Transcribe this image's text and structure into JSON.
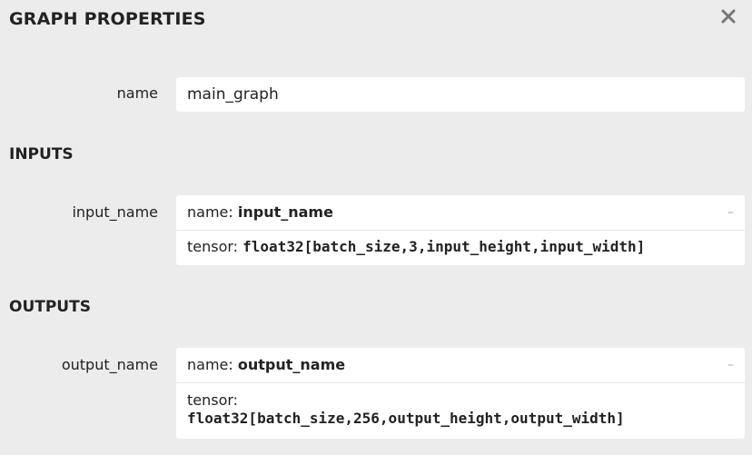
{
  "panel": {
    "title": "GRAPH PROPERTIES",
    "close_icon": "close-icon"
  },
  "properties": {
    "name_label": "name",
    "name_value": "main_graph"
  },
  "inputs": {
    "section_title": "INPUTS",
    "items": [
      {
        "label": "input_name",
        "name_key": "name: ",
        "name_value": "input_name",
        "tensor_key": "tensor: ",
        "tensor_value": "float32[batch_size,3,input_height,input_width]",
        "collapse": "–"
      }
    ]
  },
  "outputs": {
    "section_title": "OUTPUTS",
    "items": [
      {
        "label": "output_name",
        "name_key": "name: ",
        "name_value": "output_name",
        "tensor_key": "tensor:",
        "tensor_value": "float32[batch_size,256,output_height,output_width]",
        "collapse": "–"
      }
    ]
  }
}
